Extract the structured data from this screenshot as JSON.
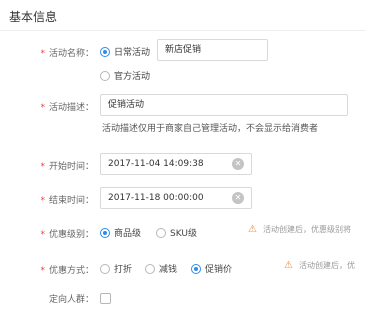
{
  "section_title": "基本信息",
  "name_row": {
    "label": "活动名称：",
    "options": [
      "日常活动",
      "官方活动"
    ],
    "selected": "日常活动",
    "input_value": "新店促销"
  },
  "desc_row": {
    "label": "活动描述：",
    "input_value": "促销活动",
    "hint": "活动描述仅用于商家自己管理活动，不会显示给消费者"
  },
  "start_row": {
    "label": "开始时间：",
    "value": "2017-11-04 14:09:38"
  },
  "end_row": {
    "label": "结束时间：",
    "value": "2017-11-18 00:00:00"
  },
  "level_row": {
    "label": "优惠级别：",
    "options": [
      "商品级",
      "SKU级"
    ],
    "selected": "商品级",
    "warning": "活动创建后，优惠级别将"
  },
  "method_row": {
    "label": "优惠方式：",
    "options": [
      "打折",
      "减钱",
      "促销价"
    ],
    "selected": "促销价",
    "warning": "活动创建后，优"
  },
  "target_row": {
    "label": "定向人群：",
    "checked": false
  },
  "required_mark": "*",
  "icons": {
    "clear": "clear-circle-icon",
    "warning": "warning-triangle-icon"
  },
  "colors": {
    "accent": "#2d8cf0",
    "required": "#e64340",
    "warning": "#f0883a"
  }
}
